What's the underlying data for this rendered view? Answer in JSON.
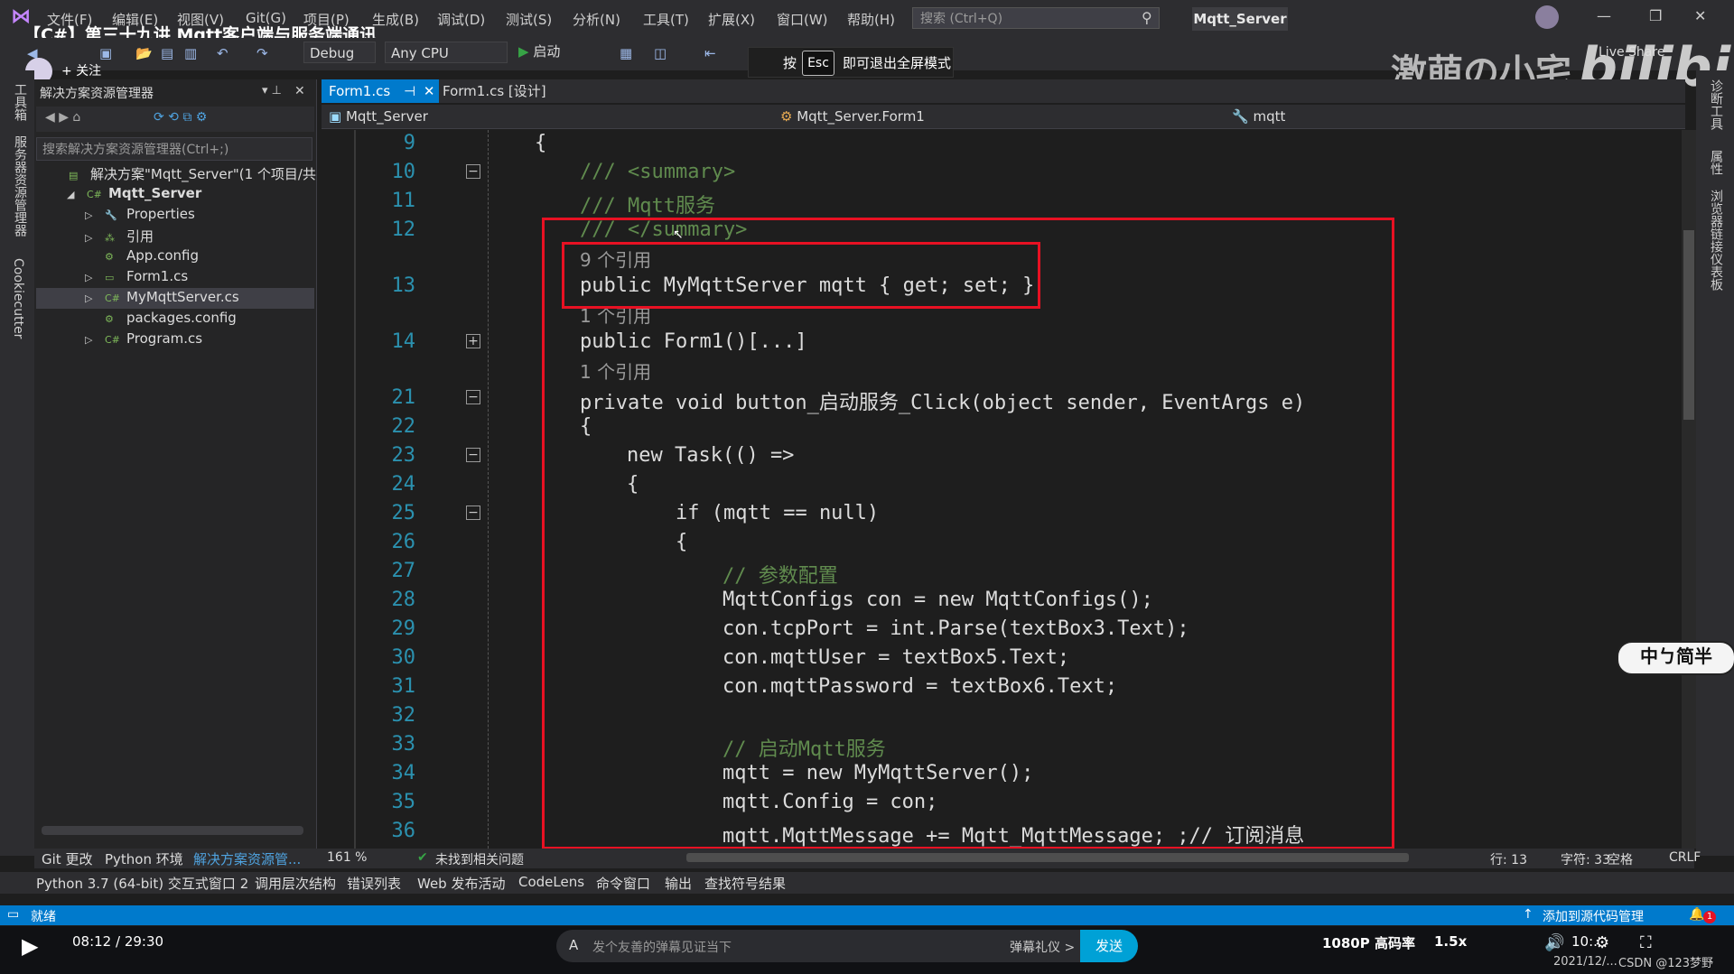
{
  "window": {
    "video_title": "【C#】第三十九讲 Mqtt客户端与服务端通讯",
    "app_title": "Mqtt_Server",
    "search_placeholder": "搜索 (Ctrl+Q)",
    "watermark": "激萌の小宅",
    "bili_logo": "bilibili",
    "live_share": "Live Share",
    "follow": "+ 关注"
  },
  "menu": [
    "文件(F)",
    "编辑(E)",
    "视图(V)",
    "Git(G)",
    "项目(P)",
    "生成(B)",
    "调试(D)",
    "测试(S)",
    "分析(N)",
    "工具(T)",
    "扩展(X)",
    "窗口(W)",
    "帮助(H)"
  ],
  "toolbar": {
    "config": "Debug",
    "platform": "Any CPU",
    "start": "启动"
  },
  "esc_tip": {
    "prefix": "按",
    "key": "Esc",
    "suffix": "即可退出全屏模式"
  },
  "left_rail": [
    "工具箱",
    "服务器资源管理器",
    "Cookiecutter"
  ],
  "right_rail": [
    "诊断工具",
    "属性",
    "浏览器链接仪表板"
  ],
  "solution_explorer": {
    "title": "解决方案资源管理器",
    "search_placeholder": "搜索解决方案资源管理器(Ctrl+;)",
    "items": [
      {
        "label": "解决方案\"Mqtt_Server\"(1 个项目/共 1",
        "icon": "solution-icon",
        "indent": 0,
        "arrow": ""
      },
      {
        "label": "Mqtt_Server",
        "icon": "csharp-project-icon",
        "indent": 1,
        "arrow": "◢",
        "bold": true
      },
      {
        "label": "Properties",
        "icon": "wrench-icon",
        "indent": 2,
        "arrow": "▷"
      },
      {
        "label": "引用",
        "icon": "references-icon",
        "indent": 2,
        "arrow": "▷"
      },
      {
        "label": "App.config",
        "icon": "config-file-icon",
        "indent": 2,
        "arrow": ""
      },
      {
        "label": "Form1.cs",
        "icon": "form-icon",
        "indent": 2,
        "arrow": "▷"
      },
      {
        "label": "MyMqttServer.cs",
        "icon": "csharp-file-icon",
        "indent": 2,
        "arrow": "▷"
      },
      {
        "label": "packages.config",
        "icon": "config-file-icon",
        "indent": 2,
        "arrow": ""
      },
      {
        "label": "Program.cs",
        "icon": "csharp-file-icon",
        "indent": 2,
        "arrow": "▷"
      }
    ]
  },
  "tabs": [
    {
      "label": "Form1.cs",
      "active": true
    },
    {
      "label": "Form1.cs [设计]",
      "active": false
    }
  ],
  "nav": {
    "project": "Mqtt_Server",
    "class": "Mqtt_Server.Form1",
    "member": "mqtt"
  },
  "code": {
    "lines": [
      {
        "num": "9",
        "text": "{"
      },
      {
        "num": "10",
        "text": "/// <summary>"
      },
      {
        "num": "11",
        "text": "/// Mqtt服务"
      },
      {
        "num": "12",
        "text": "/// </summary>"
      },
      {
        "ref": "9 个引用"
      },
      {
        "num": "13",
        "text": "public MyMqttServer mqtt { get; set; }"
      },
      {
        "ref": "1 个引用"
      },
      {
        "num": "14",
        "text": "public Form1()[...]"
      },
      {
        "ref": "1 个引用"
      },
      {
        "num": "21",
        "text": "private void button_启动服务_Click(object sender, EventArgs e)"
      },
      {
        "num": "22",
        "text": "{"
      },
      {
        "num": "23",
        "text": "new Task(() =>"
      },
      {
        "num": "24",
        "text": "{"
      },
      {
        "num": "25",
        "text": "if (mqtt == null)"
      },
      {
        "num": "26",
        "text": "{"
      },
      {
        "num": "27",
        "text": "// 参数配置"
      },
      {
        "num": "28",
        "text": "MqttConfigs con = new MqttConfigs();"
      },
      {
        "num": "29",
        "text": "con.tcpPort = int.Parse(textBox3.Text);"
      },
      {
        "num": "30",
        "text": "con.mqttUser = textBox5.Text;"
      },
      {
        "num": "31",
        "text": "con.mqttPassword = textBox6.Text;"
      },
      {
        "num": "32",
        "text": ""
      },
      {
        "num": "33",
        "text": "// 启动Mqtt服务"
      },
      {
        "num": "34",
        "text": "mqtt = new MyMqttServer();"
      },
      {
        "num": "35",
        "text": "mqtt.Config = con;"
      },
      {
        "num": "36",
        "text": "mqtt.MqttMessage += Mqtt_MqttMessage; ;// 订阅消息"
      }
    ]
  },
  "editor_status": {
    "zoom": "161 %",
    "issues": "未找到相关问题",
    "line": "行: 13",
    "col": "字符: 33",
    "spacing": "空格",
    "eol": "CRLF"
  },
  "bottom_tabs_left": [
    "Git 更改",
    "Python 环境",
    "解决方案资源管..."
  ],
  "bottom_tabs": [
    "Python 3.7 (64-bit) 交互式窗口 2",
    "调用层次结构",
    "错误列表",
    "Web 发布活动",
    "CodeLens",
    "命令窗口",
    "输出",
    "查找符号结果"
  ],
  "status": {
    "ready": "就绪",
    "source_control": "添加到源代码管理",
    "notifications": "1"
  },
  "player": {
    "time": "08:12 / 29:30",
    "danmaku_placeholder": "发个友善的弹幕见证当下",
    "gift": "弹幕礼仪 >",
    "send": "发送",
    "quality": "1080P 高码率",
    "speed": "1.5x",
    "clock": "10:...",
    "date": "2021/12/...",
    "csdn": "CSDN @123梦野"
  },
  "ime": "中ㄅ简半",
  "colors": {
    "accent": "#007acc",
    "highlight_box": "#e81123",
    "bg": "#1e1e1e"
  }
}
